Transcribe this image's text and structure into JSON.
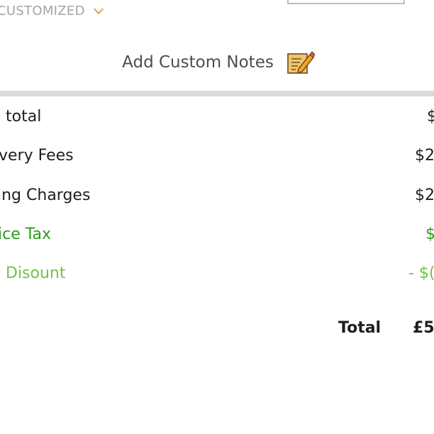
{
  "customized": {
    "label": "CUSTOMIZED"
  },
  "notes": {
    "label": "Add Custom Notes",
    "icon": "edit-note-icon"
  },
  "summary": {
    "rows": [
      {
        "label": "total",
        "value": "$"
      },
      {
        "label": "very Fees",
        "value": "$2"
      },
      {
        "label": "ing Charges",
        "value": "$2"
      },
      {
        "label": "ice Tax",
        "value": "$"
      },
      {
        "label": "Disount",
        "value": "- $("
      }
    ],
    "total_label": "Total",
    "total_value": "£5"
  },
  "colors": {
    "accent_chevron": "#d7a84c",
    "tax_green": "#2a9d1d",
    "discount_green": "#72c24a",
    "divider": "#dadada"
  }
}
